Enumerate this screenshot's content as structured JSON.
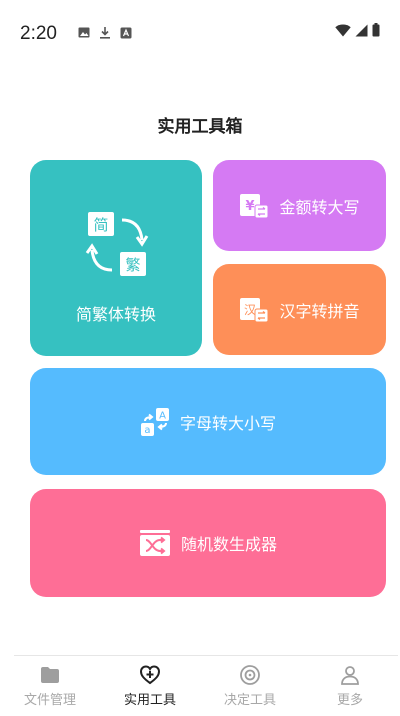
{
  "status_bar": {
    "time": "2:20",
    "icons_left": [
      "image-icon",
      "download-icon",
      "font-icon"
    ],
    "icons_right": [
      "wifi-icon",
      "signal-icon",
      "battery-icon"
    ]
  },
  "page": {
    "title": "实用工具箱"
  },
  "tools": {
    "fanjian": {
      "label": "简繁体转换",
      "glyph_simple": "简",
      "glyph_traditional": "繁",
      "color": "#36C1C1"
    },
    "amount": {
      "label": "金额转大写",
      "glyph": "¥",
      "color": "#D57AF3"
    },
    "pinyin": {
      "label": "汉字转拼音",
      "glyph": "汉",
      "color": "#FE8F58"
    },
    "case": {
      "label": "字母转大小写",
      "glyph_upper": "A",
      "glyph_lower": "a",
      "color": "#55BBFE"
    },
    "random": {
      "label": "随机数生成器",
      "color": "#FE6E96"
    }
  },
  "tabbar": {
    "active_index": 1,
    "tabs": [
      {
        "label": "文件管理",
        "icon": "folder-icon"
      },
      {
        "label": "实用工具",
        "icon": "heart-plus-icon"
      },
      {
        "label": "决定工具",
        "icon": "target-icon"
      },
      {
        "label": "更多",
        "icon": "person-icon"
      }
    ]
  }
}
